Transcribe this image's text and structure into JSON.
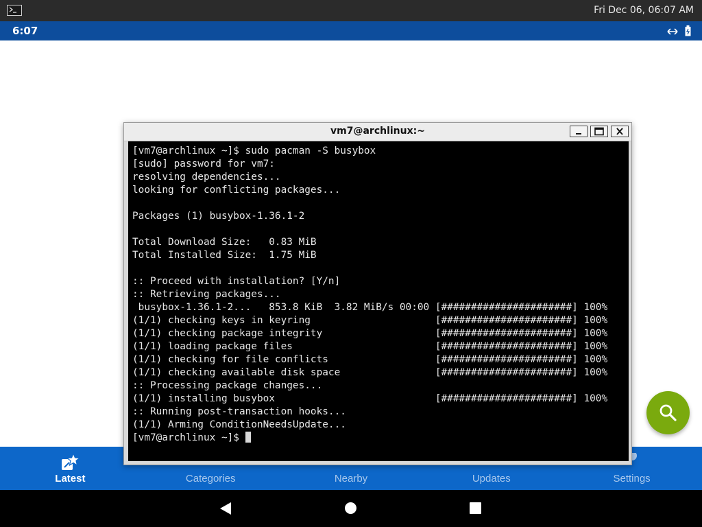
{
  "topbar": {
    "clock": "Fri Dec 06, 06:07 AM",
    "icon": "terminal-icon"
  },
  "statusbar": {
    "time": "6:07",
    "icons": [
      "network-icon",
      "battery-icon"
    ]
  },
  "terminal": {
    "title": "vm7@archlinux:~",
    "lines": [
      "[vm7@archlinux ~]$ sudo pacman -S busybox",
      "[sudo] password for vm7:",
      "resolving dependencies...",
      "looking for conflicting packages...",
      "",
      "Packages (1) busybox-1.36.1-2",
      "",
      "Total Download Size:   0.83 MiB",
      "Total Installed Size:  1.75 MiB",
      "",
      ":: Proceed with installation? [Y/n]",
      ":: Retrieving packages...",
      " busybox-1.36.1-2...   853.8 KiB  3.82 MiB/s 00:00 [######################] 100%",
      "(1/1) checking keys in keyring                     [######################] 100%",
      "(1/1) checking package integrity                   [######################] 100%",
      "(1/1) loading package files                        [######################] 100%",
      "(1/1) checking for file conflicts                  [######################] 100%",
      "(1/1) checking available disk space                [######################] 100%",
      ":: Processing package changes...",
      "(1/1) installing busybox                           [######################] 100%",
      ":: Running post-transaction hooks...",
      "(1/1) Arming ConditionNeedsUpdate...",
      "[vm7@archlinux ~]$ "
    ]
  },
  "fab": {
    "icon": "search-icon",
    "color": "#7aaa0e"
  },
  "bottom_nav": {
    "items": [
      {
        "label": "Latest",
        "icon": "latest-icon",
        "active": true
      },
      {
        "label": "Categories",
        "icon": "categories-icon",
        "active": false
      },
      {
        "label": "Nearby",
        "icon": "nearby-icon",
        "active": false
      },
      {
        "label": "Updates",
        "icon": "updates-icon",
        "active": false
      },
      {
        "label": "Settings",
        "icon": "settings-icon",
        "active": false
      }
    ]
  },
  "colors": {
    "statusbar": "#0d4d9c",
    "bottom_nav": "#0d67c9",
    "fab": "#7aaa0e"
  }
}
